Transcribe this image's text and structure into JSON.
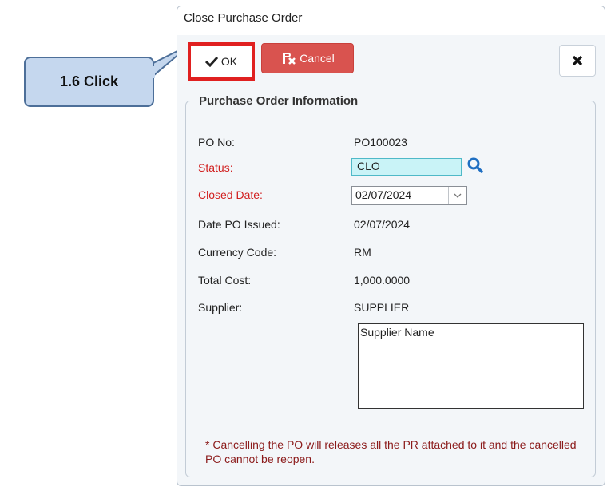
{
  "dialog": {
    "title": "Close Purchase Order",
    "toolbar": {
      "ok_label": "OK",
      "cancel_label": "Cancel",
      "close_icon": "close-x-icon"
    },
    "section_title": "Purchase Order Information",
    "fields": {
      "po_no_label": "PO No:",
      "po_no_value": "PO100023",
      "status_label": "Status:",
      "status_value": "CLO",
      "closed_date_label": "Closed Date:",
      "closed_date_value": "02/07/2024",
      "date_issued_label": "Date PO Issued:",
      "date_issued_value": "02/07/2024",
      "currency_label": "Currency Code:",
      "currency_value": "RM",
      "total_cost_label": "Total Cost:",
      "total_cost_value": "1,000.0000",
      "supplier_label": "Supplier:",
      "supplier_value": "SUPPLIER",
      "supplier_name": "Supplier Name"
    },
    "note": "* Cancelling the PO will releases all the PR attached to it and the cancelled PO cannot be reopen."
  },
  "annotation": {
    "callout_text": "1.6 Click"
  },
  "colors": {
    "highlight": "#e02020",
    "cancel_button": "#d9534f",
    "status_field": "#c9f3f7",
    "required_label": "#d11f1f",
    "callout_fill": "#c5d7ee"
  }
}
